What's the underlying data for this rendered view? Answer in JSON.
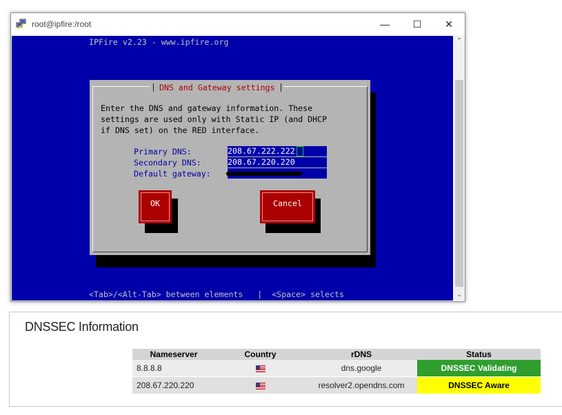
{
  "window": {
    "title": "root@ipfire:/root",
    "controls": {
      "minimize": "—",
      "maximize": "☐",
      "close": "✕"
    },
    "icon": "putty-icon"
  },
  "terminal": {
    "header": "IPFire v2.23 - www.ipfire.org",
    "footer": "<Tab>/<Alt-Tab> between elements   |  <Space> selects",
    "dialog": {
      "title": "DNS and Gateway settings",
      "description_lines": [
        "Enter the DNS and gateway information. These",
        "settings are used only with Static IP (and DHCP",
        "if DNS set) on the RED interface."
      ],
      "fields": [
        {
          "label": "Primary DNS:",
          "value": "208.67.222.222"
        },
        {
          "label": "Secondary DNS:",
          "value": "208.67.220.220"
        },
        {
          "label": "Default gateway:",
          "value": ""
        }
      ],
      "ok_label": "OK",
      "cancel_label": "Cancel"
    },
    "colors": {
      "background": "#0000aa",
      "dialog": "#b4b4b4",
      "button": "#aa0000"
    }
  },
  "dnssec": {
    "title": "DNSSEC Information",
    "columns": [
      "Nameserver",
      "Country",
      "rDNS",
      "Status"
    ],
    "rows": [
      {
        "nameserver": "8.8.8.8",
        "country_icon": "us-flag-icon",
        "rdns": "dns.google",
        "status": "DNSSEC Validating",
        "status_color": "#2f9e2f"
      },
      {
        "nameserver": "208.67.220.220",
        "country_icon": "us-flag-icon",
        "rdns": "resolver2.opendns.com",
        "status": "DNSSEC Aware",
        "status_color": "#ffff00"
      }
    ]
  }
}
